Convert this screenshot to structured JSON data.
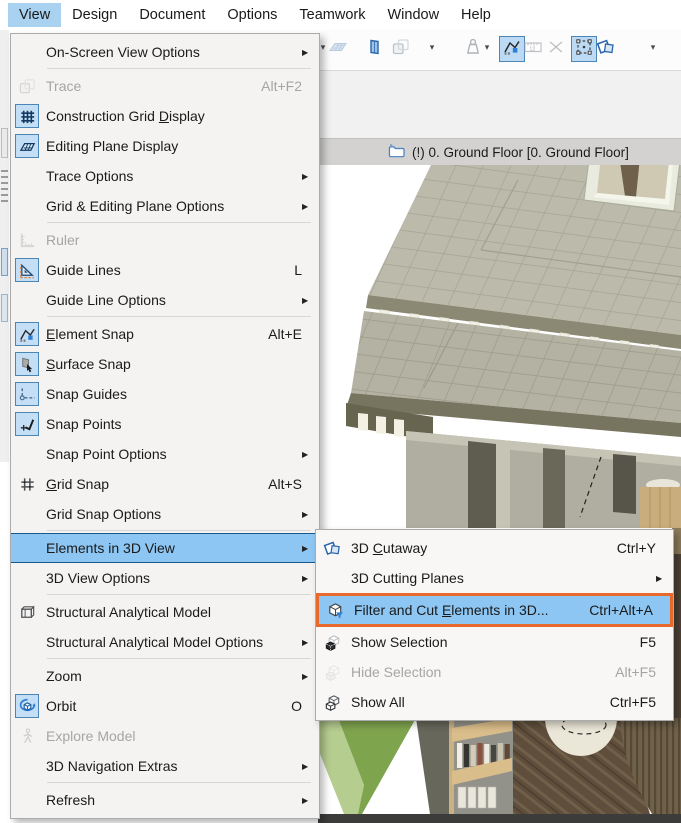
{
  "menubar": {
    "items": [
      {
        "label": "View",
        "active": true
      },
      {
        "label": "Design"
      },
      {
        "label": "Document"
      },
      {
        "label": "Options"
      },
      {
        "label": "Teamwork"
      },
      {
        "label": "Window"
      },
      {
        "label": "Help"
      }
    ]
  },
  "toolbar": {
    "buttons": [
      {
        "icon": "dropdown-caret",
        "caret_only": true
      },
      {
        "icon": "grid-slab",
        "state": "disabled"
      },
      {
        "icon": "blue-panel",
        "state": "normal"
      },
      {
        "icon": "trace",
        "state": "disabled",
        "caret": true
      },
      {
        "icon": "weight",
        "state": "disabled",
        "caret": true
      },
      {
        "icon": "element-snap",
        "state": "active"
      },
      {
        "icon": "ruler-12",
        "state": "disabled"
      },
      {
        "icon": "pinch-x",
        "state": "disabled"
      },
      {
        "icon": "marquee",
        "state": "active"
      },
      {
        "icon": "cutaway",
        "state": "normal",
        "caret": true
      }
    ]
  },
  "tab_bar": {
    "icon": "folder-icon",
    "label": "(!) 0. Ground Floor [0. Ground Floor]"
  },
  "view_menu": {
    "items": [
      {
        "label_pre": "On-Screen View Options",
        "submenu": true
      },
      {
        "type": "separator"
      },
      {
        "label_pre": "Trace",
        "shortcut": "Alt+F2",
        "icon": "trace",
        "disabled": true
      },
      {
        "label_pre": "Construction Grid ",
        "label_key": "D",
        "label_post": "isplay",
        "icon": "construction-grid",
        "icon_active": true
      },
      {
        "label_pre": "Editing Plane Display",
        "icon": "editing-plane",
        "icon_active": true
      },
      {
        "label_pre": "Trace Options",
        "submenu": true
      },
      {
        "label_pre": "Grid & Editing Plane Options",
        "submenu": true
      },
      {
        "type": "separator"
      },
      {
        "label_pre": "Ruler",
        "icon": "ruler",
        "disabled": true
      },
      {
        "label_pre": "Guide Lines",
        "shortcut": "L",
        "icon": "guide-lines",
        "icon_active": true
      },
      {
        "label_pre": "Guide Line Options",
        "submenu": true
      },
      {
        "type": "separator"
      },
      {
        "label_pre": "",
        "label_key": "E",
        "label_post": "lement Snap",
        "shortcut": "Alt+E",
        "icon": "element-snap",
        "icon_active": true
      },
      {
        "label_pre": "",
        "label_key": "S",
        "label_post": "urface Snap",
        "icon": "surface-snap",
        "icon_active": true
      },
      {
        "label_pre": "Snap Guides",
        "icon": "snap-guides",
        "icon_active": true
      },
      {
        "label_pre": "Snap Points",
        "icon": "snap-points",
        "icon_active": true
      },
      {
        "label_pre": "Snap Point Options",
        "submenu": true
      },
      {
        "label_pre": "",
        "label_key": "G",
        "label_post": "rid Snap",
        "shortcut": "Alt+S",
        "icon": "grid-snap"
      },
      {
        "label_pre": "Grid Snap Options",
        "submenu": true
      },
      {
        "type": "separator"
      },
      {
        "label_pre": "Elements in 3D View",
        "submenu": true,
        "highlighted": true
      },
      {
        "label_pre": "3D View Options",
        "submenu": true
      },
      {
        "type": "separator"
      },
      {
        "label_pre": "Structural Analytical Model",
        "icon": "structural-model"
      },
      {
        "label_pre": "Structural Analytical Model Options",
        "submenu": true
      },
      {
        "type": "separator"
      },
      {
        "label_pre": "Zoom",
        "submenu": true
      },
      {
        "label_pre": "Orbit",
        "shortcut": "O",
        "icon": "orbit",
        "icon_active": true
      },
      {
        "label_pre": "Explore Model",
        "icon": "explore",
        "disabled": true
      },
      {
        "label_pre": "3D Navigation Extras",
        "submenu": true
      },
      {
        "type": "separator"
      },
      {
        "label_pre": "Refresh",
        "submenu": true
      }
    ]
  },
  "elements_3d_submenu": {
    "items": [
      {
        "label_pre": "3D ",
        "label_key": "C",
        "label_post": "utaway",
        "shortcut": "Ctrl+Y",
        "icon": "cutaway"
      },
      {
        "label_pre": "3D Cutting Planes",
        "submenu": true
      },
      {
        "label_pre": "Filter and Cut ",
        "label_key": "E",
        "label_post": "lements in 3D...",
        "shortcut": "Ctrl+Alt+A",
        "icon": "filter-cut",
        "selected": true
      },
      {
        "label_pre": "Show Selection",
        "shortcut": "F5",
        "icon": "show-selection"
      },
      {
        "label_pre": "Hide Selection",
        "shortcut": "Alt+F5",
        "icon": "hide-selection",
        "disabled": true
      },
      {
        "label_pre": "Show All",
        "shortcut": "Ctrl+F5",
        "icon": "show-all"
      }
    ]
  },
  "ui": {
    "submenu_arrow": "▶",
    "caret": "▾"
  },
  "colors": {
    "menu_highlight": "#8dc6f2",
    "menu_highlight_border": "#17598f",
    "selection_orange": "#e8692c",
    "icon_active_bg": "#c3def5",
    "icon_active_border": "#4b86b8",
    "accent_blue": "#2f7fd6",
    "roof_tiles": "#bcbaab",
    "grass": "#7fa44e",
    "parquet_floor": "#5f4e3b"
  }
}
